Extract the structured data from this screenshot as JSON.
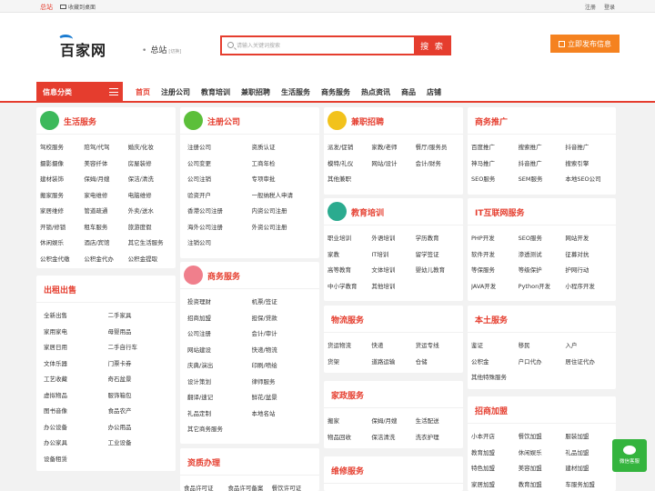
{
  "topbar": {
    "city": "总站",
    "favorite": "收藏到桌面",
    "register": "注册",
    "login": "登录"
  },
  "header": {
    "logo": "百家网",
    "station": "总站",
    "switch": "[切换]",
    "search_placeholder": "请输入关键词搜索",
    "search_button": "搜 索",
    "publish_button": "立即发布信息"
  },
  "nav": {
    "category": "信息分类",
    "items": [
      "首页",
      "注册公司",
      "教育培训",
      "兼职招聘",
      "生活服务",
      "商务服务",
      "热点资讯",
      "商品",
      "店铺"
    ]
  },
  "colors": {
    "accent": "#e53d2e",
    "orange": "#f58220",
    "green": "#34b43e"
  },
  "cards": {
    "life": {
      "title": "生活服务",
      "icon": "shopping-bag-icon",
      "items": [
        "驾校服务",
        "陪驾/代驾",
        "婚庆/化妆",
        "摄影摄像",
        "美容纤体",
        "房屋装修",
        "建材装饰",
        "保姆/月嫂",
        "保洁/清洗",
        "搬家服务",
        "家电维修",
        "电脑维修",
        "家居维修",
        "管道疏通",
        "外卖/送水",
        "开锁/修锁",
        "租车服务",
        "旅游度假",
        "休闲娱乐",
        "酒店/宾馆",
        "其它生活服务",
        "公积金代缴",
        "公积金代办",
        "公积金提取"
      ]
    },
    "rent": {
      "title": "出租出售",
      "items": [
        "全新出售",
        "二手家具",
        "家用家电",
        "母婴用品",
        "家居日用",
        "二手自行车",
        "文体乐器",
        "门票卡券",
        "工艺收藏",
        "奇石盆景",
        "虚拟物品",
        "服饰箱包",
        "图书音像",
        "食品农产",
        "办公设备",
        "办公用品",
        "办公家具",
        "工业设备",
        "设备租赁"
      ]
    },
    "company": {
      "title": "注册公司",
      "icon": "money-bag-icon",
      "items": [
        "注册公司",
        "资质认证",
        "公司变更",
        "工商年检",
        "公司注销",
        "专项审批",
        "验资开户",
        "一般纳税人申请",
        "香港公司注册",
        "内资公司注册",
        "海外公司注册",
        "外资公司注册",
        "注销公司"
      ]
    },
    "business": {
      "title": "商务服务",
      "icon": "handshake-icon",
      "items": [
        "投资理财",
        "机票/签证",
        "招商加盟",
        "担保/贷款",
        "公司注册",
        "会计/审计",
        "网站建设",
        "快递/物流",
        "庆典/演出",
        "印刷/喷绘",
        "设计策划",
        "律师服务",
        "翻译/速记",
        "鲜花/盆景",
        "礼品定制",
        "本地名站",
        "其它商务服务"
      ]
    },
    "qualify": {
      "title": "资质办理",
      "items": [
        "食品许可证",
        "食品许可备案",
        "餐饮许可证"
      ]
    },
    "job": {
      "title": "兼职招聘",
      "icon": "coins-icon",
      "items": [
        "派发/促销",
        "家教/老师",
        "餐厅/服务员",
        "模特/礼仪",
        "网站/设计",
        "会计/财务",
        "其他兼职"
      ]
    },
    "edu": {
      "title": "教育培训",
      "icon": "graduation-cap-icon",
      "items": [
        "职业培训",
        "外语培训",
        "学历教育",
        "家教",
        "IT培训",
        "留学签证",
        "高等教育",
        "文体培训",
        "婴幼儿教育",
        "中小学教育",
        "其他培训"
      ]
    },
    "logistics": {
      "title": "物流服务",
      "items": [
        "货运物流",
        "快递",
        "货运专线",
        "货架",
        "道路运输",
        "仓储"
      ]
    },
    "home": {
      "title": "家政服务",
      "items": [
        "搬家",
        "保姆/月嫂",
        "生活配送",
        "物品回收",
        "保洁清洗",
        "洗衣护理"
      ]
    },
    "repair": {
      "title": "维修服务"
    },
    "promo": {
      "title": "商务推广",
      "items": [
        "百度推广",
        "搜索推广",
        "抖音推广",
        "神马推广",
        "抖音推广",
        "搜索引擎",
        "SEO服务",
        "SEM服务",
        "本地SEO公司"
      ]
    },
    "it": {
      "title": "IT互联网服务",
      "items": [
        "PHP开发",
        "SEO服务",
        "网站开发",
        "软件开发",
        "渗透测试",
        "征募对抗",
        "等保服务",
        "等级保护",
        "护网行动",
        "JAVA开发",
        "Python开发",
        "小程序开发"
      ]
    },
    "local": {
      "title": "本土服务",
      "items": [
        "鉴证",
        "移民",
        "入户",
        "公积金",
        "户口代办",
        "居住证代办",
        "其他特殊服务"
      ]
    },
    "franchise": {
      "title": "招商加盟",
      "items": [
        "小本开店",
        "餐饮加盟",
        "服装加盟",
        "教育加盟",
        "休闲娱乐",
        "礼品加盟",
        "特色加盟",
        "美容加盟",
        "建材加盟",
        "家居加盟",
        "教育加盟",
        "车服务加盟"
      ]
    }
  },
  "chat": {
    "label": "微信客服"
  }
}
